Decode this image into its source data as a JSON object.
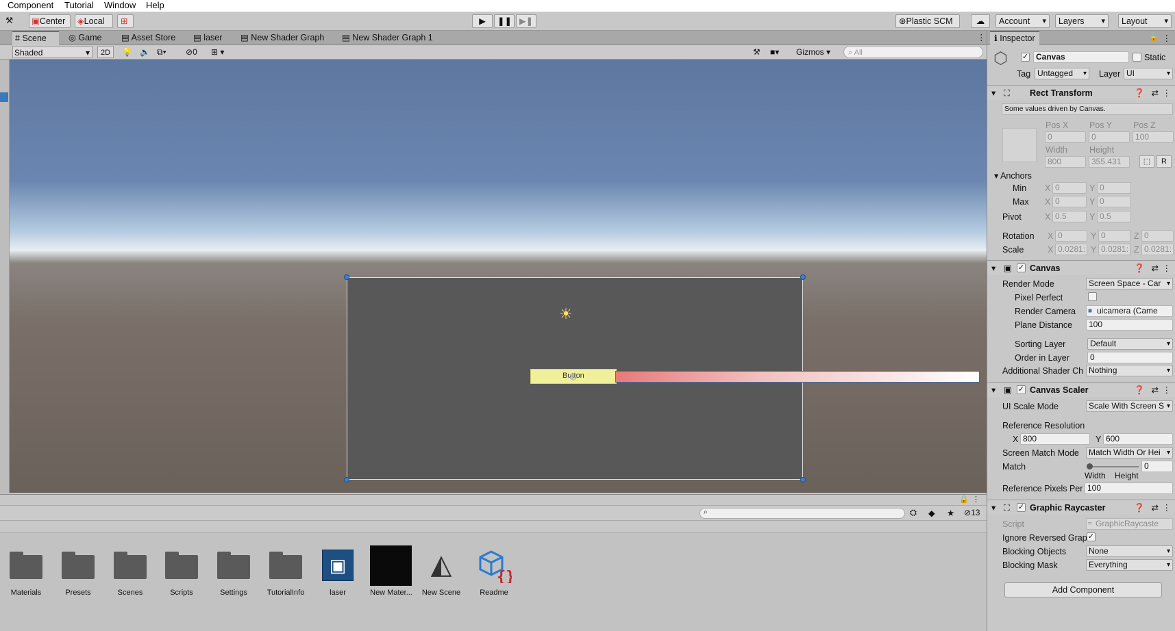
{
  "menu": [
    "Component",
    "Tutorial",
    "Window",
    "Help"
  ],
  "toolbar": {
    "pivot": "Center",
    "space": "Local",
    "plastic": "Plastic SCM",
    "account": "Account",
    "layers": "Layers",
    "layout": "Layout"
  },
  "tabs": [
    "Scene",
    "Game",
    "Asset Store",
    "laser",
    "New Shader Graph",
    "New Shader Graph 1"
  ],
  "scene_bar": {
    "shading": "Shaded",
    "mode2d": "2D",
    "hidden_count": "0",
    "gizmos": "Gizmos",
    "search_placeholder": "All"
  },
  "button_label": "Button",
  "project": {
    "hidden_count": "13",
    "assets": [
      "Materials",
      "Presets",
      "Scenes",
      "Scripts",
      "Settings",
      "TutorialInfo",
      "laser",
      "New Mater...",
      "New Scene",
      "Readme"
    ]
  },
  "inspector": {
    "title": "Inspector",
    "object_name": "Canvas",
    "static_label": "Static",
    "tag_label": "Tag",
    "tag": "Untagged",
    "layer_label": "Layer",
    "layer": "UI",
    "rect": {
      "header": "Rect Transform",
      "note": "Some values driven by Canvas.",
      "pos_x_label": "Pos X",
      "pos_y_label": "Pos Y",
      "pos_z_label": "Pos Z",
      "pos_x": "0",
      "pos_y": "0",
      "pos_z": "100",
      "width_label": "Width",
      "height_label": "Height",
      "width": "800",
      "height": "355.431",
      "r_label": "R",
      "anchors_label": "Anchors",
      "min_label": "Min",
      "max_label": "Max",
      "pivot_label": "Pivot",
      "min_x": "0",
      "min_y": "0",
      "max_x": "0",
      "max_y": "0",
      "pivot_x": "0.5",
      "pivot_y": "0.5",
      "rotation_label": "Rotation",
      "rot_x": "0",
      "rot_y": "0",
      "rot_z": "0",
      "scale_label": "Scale",
      "scale_x": "0.0281:",
      "scale_y": "0.0281:",
      "scale_z": "0.0281:"
    },
    "canvas": {
      "header": "Canvas",
      "render_mode_label": "Render Mode",
      "render_mode": "Screen Space - Car",
      "pixel_perfect_label": "Pixel Perfect",
      "render_camera_label": "Render Camera",
      "render_camera": "uicamera (Came",
      "plane_distance_label": "Plane Distance",
      "plane_distance": "100",
      "sorting_layer_label": "Sorting Layer",
      "sorting_layer": "Default",
      "order_label": "Order in Layer",
      "order": "0",
      "shader_ch_label": "Additional Shader Ch",
      "shader_ch": "Nothing"
    },
    "scaler": {
      "header": "Canvas Scaler",
      "scale_mode_label": "UI Scale Mode",
      "scale_mode": "Scale With Screen S",
      "ref_res_label": "Reference Resolution",
      "ref_x": "800",
      "ref_y": "600",
      "match_mode_label": "Screen Match Mode",
      "match_mode": "Match Width Or Hei",
      "match_label": "Match",
      "match": "0",
      "width_label": "Width",
      "height_label": "Height",
      "ppu_label": "Reference Pixels Per",
      "ppu": "100"
    },
    "raycaster": {
      "header": "Graphic Raycaster",
      "script_label": "Script",
      "script": "GraphicRaycaste",
      "ignore_label": "Ignore Reversed Grap",
      "blocking_objects_label": "Blocking Objects",
      "blocking_objects": "None",
      "blocking_mask_label": "Blocking Mask",
      "blocking_mask": "Everything"
    },
    "add_component": "Add Component"
  }
}
